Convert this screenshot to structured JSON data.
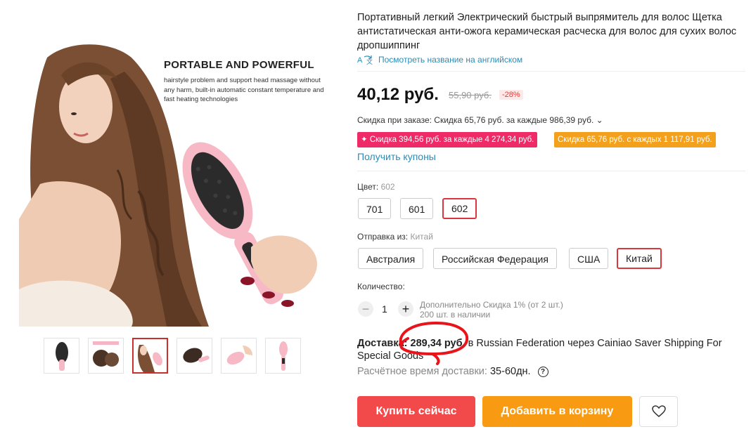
{
  "gallery": {
    "promo_title": "PORTABLE AND POWERFUL",
    "promo_text": "hairstyle problem and support head massage without any harm, built-in automatic constant temperature and fast heating technologies",
    "thumbnails": [
      "thumb-1",
      "thumb-2",
      "thumb-3",
      "thumb-4",
      "thumb-5",
      "thumb-6"
    ],
    "active_thumb": 3
  },
  "product": {
    "title": "Портативный легкий Электрический быстрый выпрямитель для волос Щетка антистатическая анти-ожога керамическая расческа для волос для сухих волос дропшиппинг",
    "translate_link": "Посмотреть название на английском",
    "price": "40,12 руб.",
    "old_price": "55,90 руб.",
    "discount_pct": "-28%",
    "order_discount": "Скидка при заказе: Скидка 65,76 руб. за каждые 986,39 руб. ⌄",
    "badge_pink": "✦ Скидка 394,56 руб. за каждые 4 274,34 руб.",
    "badge_orange": "Скидка 65,76 руб. с каждых 1 117,91 руб.",
    "coupons_link": "Получить купоны"
  },
  "color": {
    "label": "Цвет:",
    "selected": "602",
    "options": [
      "701",
      "601",
      "602"
    ]
  },
  "ship_from": {
    "label": "Отправка из:",
    "selected": "Китай",
    "options": [
      "Австралия",
      "Российская Федерация",
      "США",
      "Китай"
    ]
  },
  "quantity": {
    "label": "Количество:",
    "value": "1",
    "minus": "−",
    "plus": "+",
    "note_line1": "Дополнительно Скидка 1% (от 2 шт.)",
    "note_line2": "200 шт. в наличии"
  },
  "delivery": {
    "label": "Доставка:",
    "price": "289,34 руб.",
    "text": "в Russian Federation через Cainiao Saver Shipping For Special Goods",
    "eta_label": "Расчётное время доставки:",
    "eta_value": "35-60",
    "eta_unit": "дн.",
    "help": "?"
  },
  "actions": {
    "buy_now": "Купить сейчас",
    "add_to_cart": "Добавить в корзину"
  },
  "colors": {
    "accent_red": "#f24a4a",
    "accent_orange": "#f89a12",
    "link_blue": "#2a8cb7",
    "badge_pink": "#ee2b67",
    "annotation": "#e8141c"
  }
}
